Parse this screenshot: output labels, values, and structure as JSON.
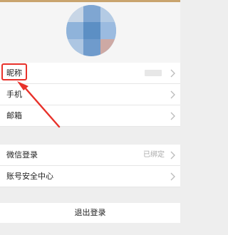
{
  "profile": {
    "avatar_icon": "avatar-pixelated"
  },
  "rows_group1": [
    {
      "label": "昵称",
      "value": ""
    },
    {
      "label": "手机",
      "value": ""
    },
    {
      "label": "邮箱",
      "value": ""
    }
  ],
  "rows_group2": [
    {
      "label": "微信登录",
      "value": "已绑定"
    },
    {
      "label": "账号安全中心",
      "value": ""
    }
  ],
  "logout": {
    "label": "退出登录"
  },
  "annotation": {
    "color": "#e8312a"
  },
  "icons": {
    "row_action": "chevron-right-icon",
    "annotation": "arrow-icon"
  }
}
